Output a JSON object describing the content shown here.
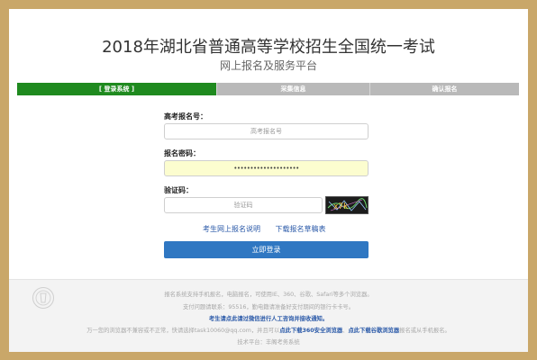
{
  "header": {
    "title": "2018年湖北省普通高等学校招生全国统一考试",
    "subtitle": "网上报名及服务平台"
  },
  "steps": [
    {
      "label": "[ 登录系统 ]",
      "active": true
    },
    {
      "label": "采集信息",
      "active": false
    },
    {
      "label": "确认报名",
      "active": false
    }
  ],
  "form": {
    "exam_no_label": "高考报名号：",
    "exam_no_placeholder": "高考报名号",
    "password_label": "报名密码：",
    "password_value": "••••••••••••••••••••",
    "captcha_label": "验证码：",
    "captcha_placeholder": "验证码",
    "captcha_icon": "captcha-image"
  },
  "links": {
    "guide": "考生网上报名说明",
    "download_form": "下载报名草稿表"
  },
  "login_button": "立即登录",
  "footer": {
    "line1": "报名系统支持手机报名，电脑报名，可使用IE、360、谷歌、Safari等多个浏览器。",
    "line2": "支付问题请联系：95516，勤电籍请准备好支付期间的银行卡卡号。",
    "line3": "考生请点此请过微信进行人工咨询并接收通知。",
    "line4_prefix": "万一您的浏览器不兼容或不正常，快请选择task10060@qq.com，并且可以",
    "line4_link1": "点此下载360安全浏览器",
    "line4_mid": "、",
    "line4_link2": "点此下载谷歌浏览器",
    "line4_suffix": "报名或从手机报名。",
    "line5": "技术平台：丰阁考务系统"
  },
  "colors": {
    "background": "#c9a769",
    "active_step": "#1f8a1f",
    "inactive_step": "#b9b9b9",
    "button": "#2f77c2",
    "link": "#2a59a8"
  }
}
